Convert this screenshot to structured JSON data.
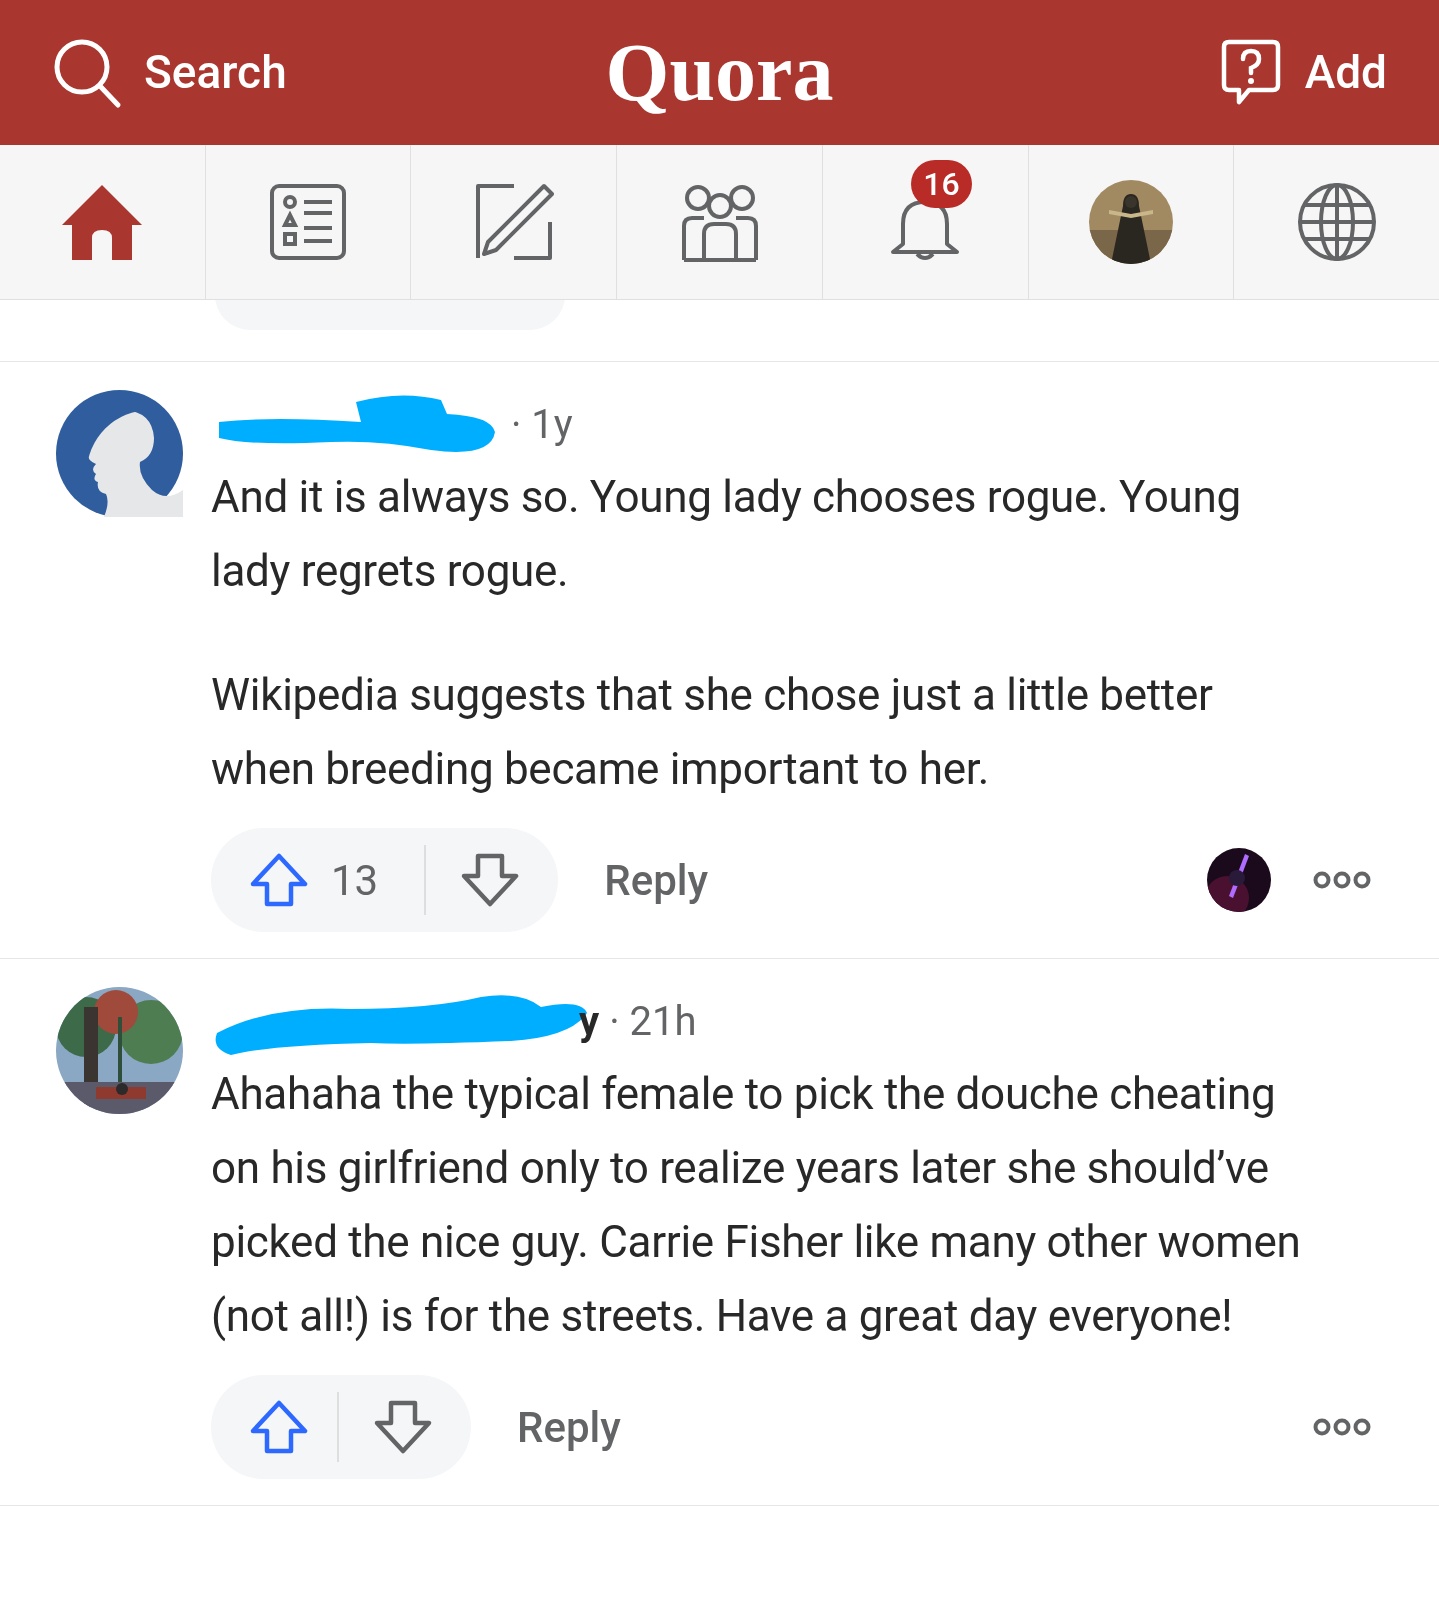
{
  "header": {
    "search_label": "Search",
    "logo": "Quora",
    "add_label": "Add"
  },
  "nav": [
    {
      "kind": "home",
      "selected": true
    },
    {
      "kind": "list",
      "selected": false
    },
    {
      "kind": "write",
      "selected": false
    },
    {
      "kind": "people",
      "selected": false
    },
    {
      "kind": "bell",
      "selected": false,
      "badge": "16"
    },
    {
      "kind": "avatar",
      "selected": false
    },
    {
      "kind": "globe",
      "selected": false
    }
  ],
  "comments": [
    {
      "avatar": {
        "kind": "silhouette"
      },
      "time": "· 1y",
      "paragraphs": [
        "And it is always so. Young lady chooses rogue. Young lady regrets rogue.",
        "Wikipedia suggests that she chose just a little better when breeding became important to her."
      ],
      "upvotes": "13",
      "reply": "Reply",
      "voter_avatar": true
    },
    {
      "avatar": {
        "kind": "picture"
      },
      "name_fragment": "y",
      "time": "· 21h",
      "paragraphs": [
        "Ahahaha the typical female to pick the douche cheating on his girlfriend only to realize years later she should’ve picked the nice guy. Carrie Fisher like many other women (not all!) is for the streets. Have a great day everyone!"
      ],
      "reply": "Reply",
      "voter_avatar": false
    }
  ]
}
